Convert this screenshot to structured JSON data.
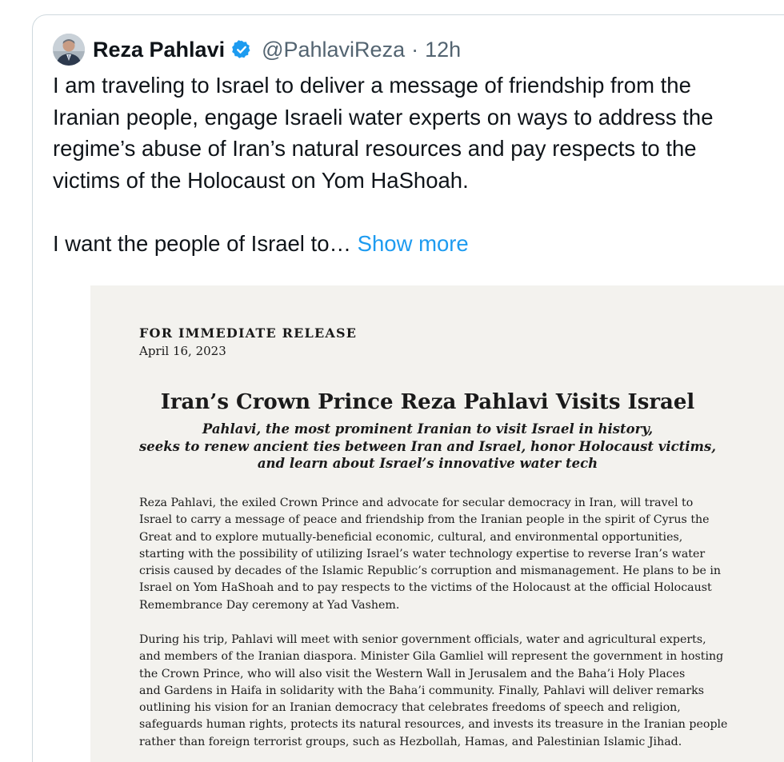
{
  "tweet": {
    "author_name": "Reza Pahlavi",
    "handle": "@PahlaviReza",
    "separator": "·",
    "time": "12h",
    "verified_icon": "verified-badge-icon",
    "colors": {
      "text": "#0f1419",
      "secondary": "#536471",
      "link": "#1d9bf0",
      "verified": "#1d9bf0",
      "border": "#cfd9de"
    },
    "text_lines_p1": [
      "I am traveling to Israel to deliver a message of friendship from the",
      "Iranian people, engage Israeli water experts on ways to address the",
      "regime’s abuse of Iran’s natural resources and pay respects to the",
      "victims of the Holocaust on Yom HaShoah."
    ],
    "text_p2": "I want the people of Israel to…",
    "show_more": "Show more"
  },
  "press_release": {
    "background": "#f3f2ee",
    "label": "FOR IMMEDIATE RELEASE",
    "date": "April 16, 2023",
    "headline": "Iran’s Crown Prince Reza Pahlavi Visits Israel",
    "subheadline_lines": [
      "Pahlavi, the most prominent Iranian to visit Israel in history,",
      "seeks to renew ancient ties between Iran and Israel, honor Holocaust victims,",
      "and learn about Israel’s innovative water tech"
    ],
    "paragraph1_lines": [
      "Reza Pahlavi, the exiled Crown Prince and advocate for secular democracy in Iran, will travel to",
      "Israel to carry a message of peace and friendship from the Iranian people in the spirit of Cyrus the",
      "Great and to explore mutually-beneficial economic, cultural, and environmental opportunities,",
      "starting with the possibility of utilizing Israel’s water technology expertise to reverse Iran’s water",
      "crisis caused by decades of the Islamic Republic’s corruption and mismanagement. He plans to be in",
      "Israel on Yom HaShoah and to pay respects to the victims of the Holocaust at the official Holocaust",
      "Remembrance Day ceremony at Yad Vashem."
    ],
    "paragraph2_lines": [
      "During his trip, Pahlavi will meet with senior government officials, water and agricultural experts,",
      "and members of the Iranian diaspora. Minister Gila Gamliel will represent the government in hosting",
      "the Crown Prince, who will also visit the Western Wall in Jerusalem and the Baha’i Holy Places",
      "and Gardens in Haifa in solidarity with the Baha’i community. Finally, Pahlavi will deliver remarks",
      "outlining his vision for an Iranian democracy that celebrates freedoms of speech and religion,",
      "safeguards human rights, protects its natural resources, and invests its treasure in the Iranian people",
      "rather than foreign terrorist groups, such as Hezbollah, Hamas, and Palestinian Islamic Jihad."
    ]
  }
}
